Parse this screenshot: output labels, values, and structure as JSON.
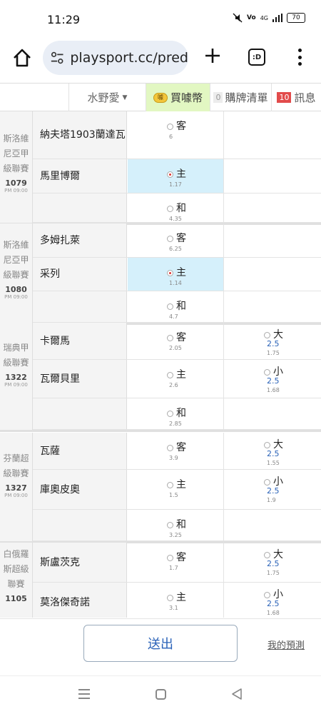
{
  "status_bar": {
    "time": "11:29",
    "network": "4G",
    "battery": "70"
  },
  "browser": {
    "url": "playsport.cc/pred",
    "tabs_label": ":D"
  },
  "topnav": {
    "user": "水野愛",
    "buy_coin": "買噱幣",
    "cart_count": "0",
    "cart": "購牌清單",
    "msg_count": "10",
    "msg": "訊息",
    "coin_icon_text": "噱"
  },
  "matches": [
    {
      "league": [
        "斯洛維",
        "尼亞甲",
        "級聯賽"
      ],
      "id": "1079",
      "time": "PM 09:00",
      "rows": [
        {
          "team": "納夫塔1903蘭達瓦",
          "pick": "客",
          "odds": "6",
          "selected": false
        },
        {
          "team": "馬里博爾",
          "pick": "主",
          "odds": "1.17",
          "selected": true
        },
        {
          "team": "",
          "pick": "和",
          "odds": "4.35",
          "selected": false
        }
      ]
    },
    {
      "league": [
        "斯洛維",
        "尼亞甲",
        "級聯賽"
      ],
      "id": "1080",
      "time": "PM 09:00",
      "rows": [
        {
          "team": "多姆扎萊",
          "pick": "客",
          "odds": "6.25",
          "selected": false
        },
        {
          "team": "采列",
          "pick": "主",
          "odds": "1.14",
          "selected": true
        },
        {
          "team": "",
          "pick": "和",
          "odds": "4.7",
          "selected": false
        }
      ]
    },
    {
      "league": [
        "瑞典甲",
        "級聯賽"
      ],
      "id": "1322",
      "time": "PM 09:00",
      "rows": [
        {
          "team": "卡爾馬",
          "pick": "客",
          "odds": "2.05",
          "selected": false,
          "ou": {
            "label": "大",
            "line": "2.5",
            "odds": "1.75"
          }
        },
        {
          "team": "瓦爾貝里",
          "pick": "主",
          "odds": "2.6",
          "selected": false,
          "ou": {
            "label": "小",
            "line": "2.5",
            "odds": "1.68"
          }
        },
        {
          "team": "",
          "pick": "和",
          "odds": "2.85",
          "selected": false
        }
      ]
    },
    {
      "league": [
        "芬蘭超",
        "級聯賽"
      ],
      "id": "1327",
      "time": "PM 09:00",
      "rows": [
        {
          "team": "瓦薩",
          "pick": "客",
          "odds": "3.9",
          "selected": false,
          "ou": {
            "label": "大",
            "line": "2.5",
            "odds": "1.55"
          }
        },
        {
          "team": "庫奧皮奧",
          "pick": "主",
          "odds": "1.5",
          "selected": false,
          "ou": {
            "label": "小",
            "line": "2.5",
            "odds": "1.9"
          }
        },
        {
          "team": "",
          "pick": "和",
          "odds": "3.25",
          "selected": false
        }
      ]
    },
    {
      "league": [
        "白俄羅",
        "斯超級",
        "聯賽"
      ],
      "id": "1105",
      "time": "",
      "rows": [
        {
          "team": "斯盧茨克",
          "pick": "客",
          "odds": "1.7",
          "selected": false,
          "ou": {
            "label": "大",
            "line": "2.5",
            "odds": "1.75"
          }
        },
        {
          "team": "莫洛傑奇諾",
          "pick": "主",
          "odds": "3.1",
          "selected": false,
          "ou": {
            "label": "小",
            "line": "2.5",
            "odds": "1.68"
          }
        }
      ]
    }
  ],
  "footer": {
    "submit": "送出",
    "my_predictions": "我的預測"
  }
}
